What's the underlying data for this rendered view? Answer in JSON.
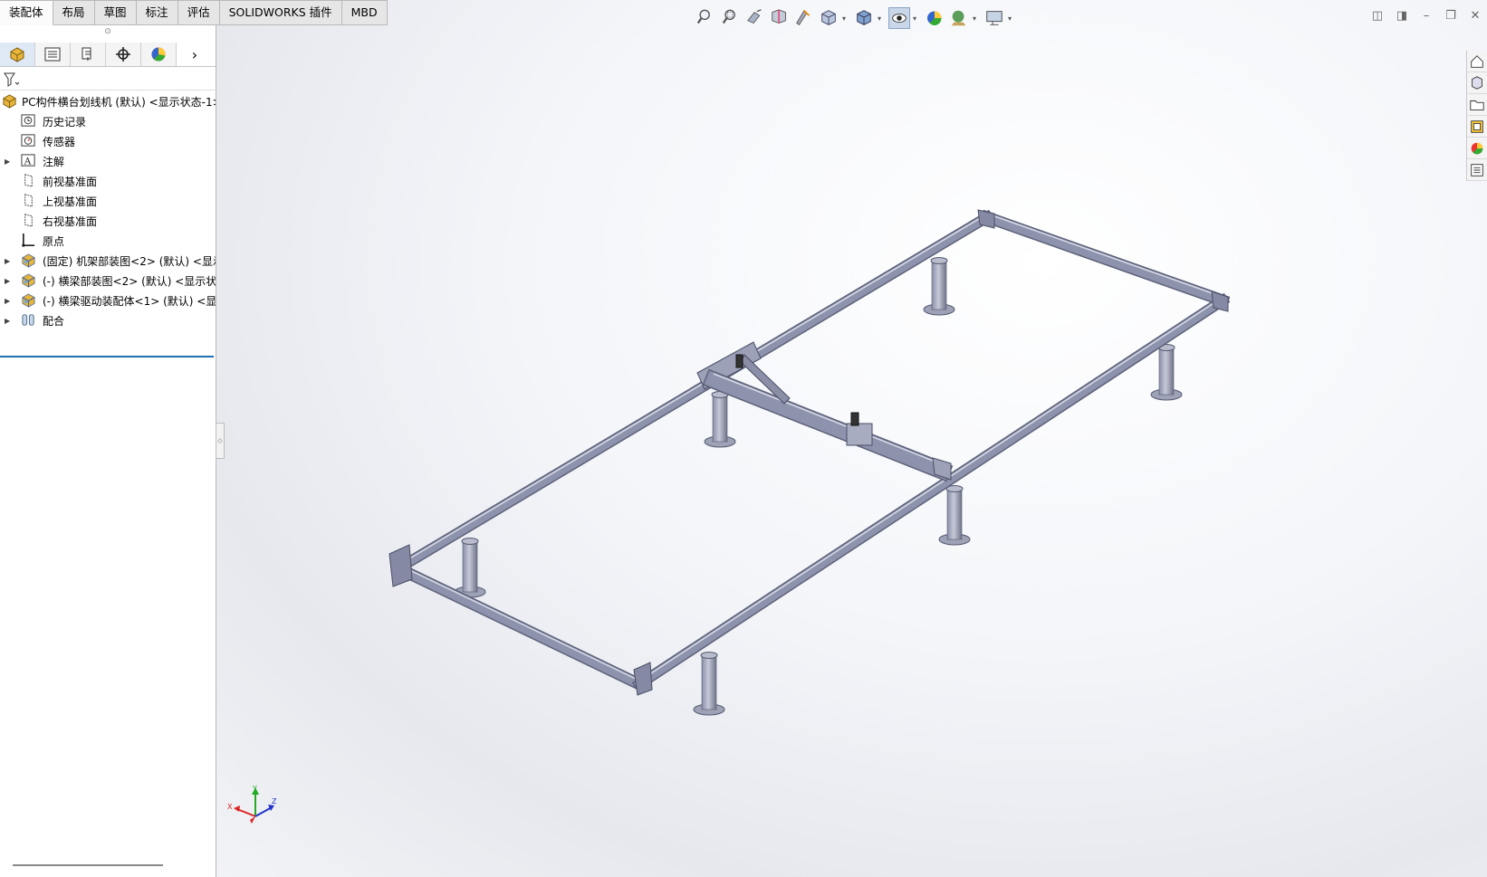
{
  "tabs": [
    {
      "label": "装配体",
      "active": true
    },
    {
      "label": "布局",
      "active": false
    },
    {
      "label": "草图",
      "active": false
    },
    {
      "label": "标注",
      "active": false
    },
    {
      "label": "评估",
      "active": false
    },
    {
      "label": "SOLIDWORKS 插件",
      "active": false
    },
    {
      "label": "MBD",
      "active": false
    }
  ],
  "panel_tabs": [
    {
      "icon": "feature-manager-icon",
      "active": true
    },
    {
      "icon": "property-manager-icon",
      "active": false
    },
    {
      "icon": "configuration-manager-icon",
      "active": false
    },
    {
      "icon": "dimxpert-manager-icon",
      "active": false
    },
    {
      "icon": "display-manager-icon",
      "active": false
    }
  ],
  "filter": {
    "icon": "filter-icon",
    "value": ""
  },
  "tree": {
    "root": "PC构件横台划线机 (默认) <显示状态-1>",
    "items": [
      {
        "label": "历史记录",
        "icon": "history-icon",
        "expandable": false
      },
      {
        "label": "传感器",
        "icon": "sensor-icon",
        "expandable": false
      },
      {
        "label": "注解",
        "icon": "annotation-icon",
        "expandable": true
      },
      {
        "label": "前视基准面",
        "icon": "plane-icon",
        "expandable": false
      },
      {
        "label": "上视基准面",
        "icon": "plane-icon",
        "expandable": false
      },
      {
        "label": "右视基准面",
        "icon": "plane-icon",
        "expandable": false
      },
      {
        "label": "原点",
        "icon": "origin-icon",
        "expandable": false
      },
      {
        "label": "(固定) 机架部装图<2> (默认) <显示",
        "icon": "subassembly-icon",
        "expandable": true
      },
      {
        "label": "(-) 横梁部装图<2> (默认) <显示状",
        "icon": "subassembly-icon",
        "expandable": true
      },
      {
        "label": "(-) 横梁驱动装配体<1> (默认) <显示",
        "icon": "subassembly-icon",
        "expandable": true
      },
      {
        "label": "配合",
        "icon": "mates-icon",
        "expandable": true
      }
    ]
  },
  "hud": [
    {
      "icon": "zoom-to-fit-icon"
    },
    {
      "icon": "zoom-to-area-icon"
    },
    {
      "icon": "previous-view-icon"
    },
    {
      "icon": "section-view-icon"
    },
    {
      "icon": "dynamic-annotation-icon"
    },
    {
      "icon": "view-orientation-icon"
    },
    {
      "icon": "display-style-icon"
    },
    {
      "icon": "hide-show-items-icon"
    },
    {
      "icon": "edit-appearance-icon"
    },
    {
      "icon": "apply-scene-icon"
    },
    {
      "icon": "view-settings-icon"
    }
  ],
  "window_controls": [
    "tile-left-icon",
    "tile-right-icon",
    "minimize-icon",
    "restore-icon",
    "close-icon"
  ],
  "task_pane": [
    "solidworks-resources-icon",
    "design-library-icon",
    "file-explorer-icon",
    "view-palette-icon",
    "appearances-icon",
    "custom-properties-icon"
  ],
  "triad": {
    "x": "X",
    "y": "Y",
    "z": "Z"
  },
  "colors": {
    "accent": "#1f6fb0",
    "frame_steel": "#8e93ad",
    "leg_steel": "#7d8296",
    "triad_x": "#d22",
    "triad_y": "#2a2",
    "triad_z": "#23c"
  }
}
